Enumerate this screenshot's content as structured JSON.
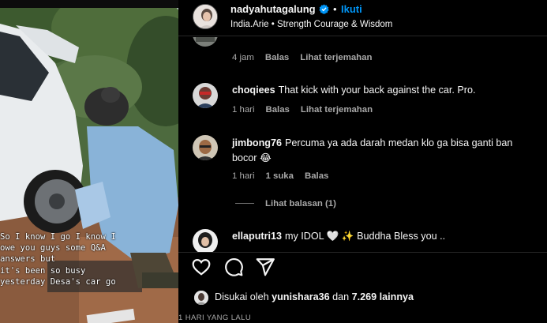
{
  "media": {
    "caption_lines": [
      "So I know I go I know I",
      "owe you guys some Q&A",
      "answers but",
      "it's been so busy",
      "yesterday Desa's car go"
    ]
  },
  "header": {
    "username": "nadyahutagalung",
    "separator": "•",
    "follow_label": "Ikuti",
    "subtitle": "India.Arie • Strength Courage & Wisdom"
  },
  "comments": [
    {
      "username": "",
      "text": "",
      "time": "4 jam",
      "reply_label": "Balas",
      "translate_label": "Lihat terjemahan"
    },
    {
      "username": "choqiees",
      "text": "That kick with your back against the car. Pro.",
      "time": "1 hari",
      "reply_label": "Balas",
      "translate_label": "Lihat terjemahan"
    },
    {
      "username": "jimbong76",
      "text": "Percuma ya ada darah medan klo ga bisa ganti ban bocor 😂",
      "time": "1 hari",
      "likes_label": "1 suka",
      "reply_label": "Balas",
      "view_replies_label": "Lihat balasan (1)"
    },
    {
      "username": "ellaputri13",
      "text": "my IDOL 🤍 ✨ Buddha Bless you .."
    }
  ],
  "footer": {
    "liked_by_prefix": "Disukai oleh",
    "liked_by_user": "yunishara36",
    "liked_by_and": "dan",
    "liked_by_others": "7.269 lainnya",
    "timestamp": "1 HARI YANG LALU"
  },
  "colors": {
    "background": "#000000",
    "text": "#f5f5f5",
    "secondary_text": "#a8a8a8",
    "follow_blue": "#0095f6",
    "verified_blue": "#0095f6"
  },
  "icons": [
    "verified-badge-icon",
    "heart-icon",
    "comment-icon",
    "share-icon"
  ]
}
